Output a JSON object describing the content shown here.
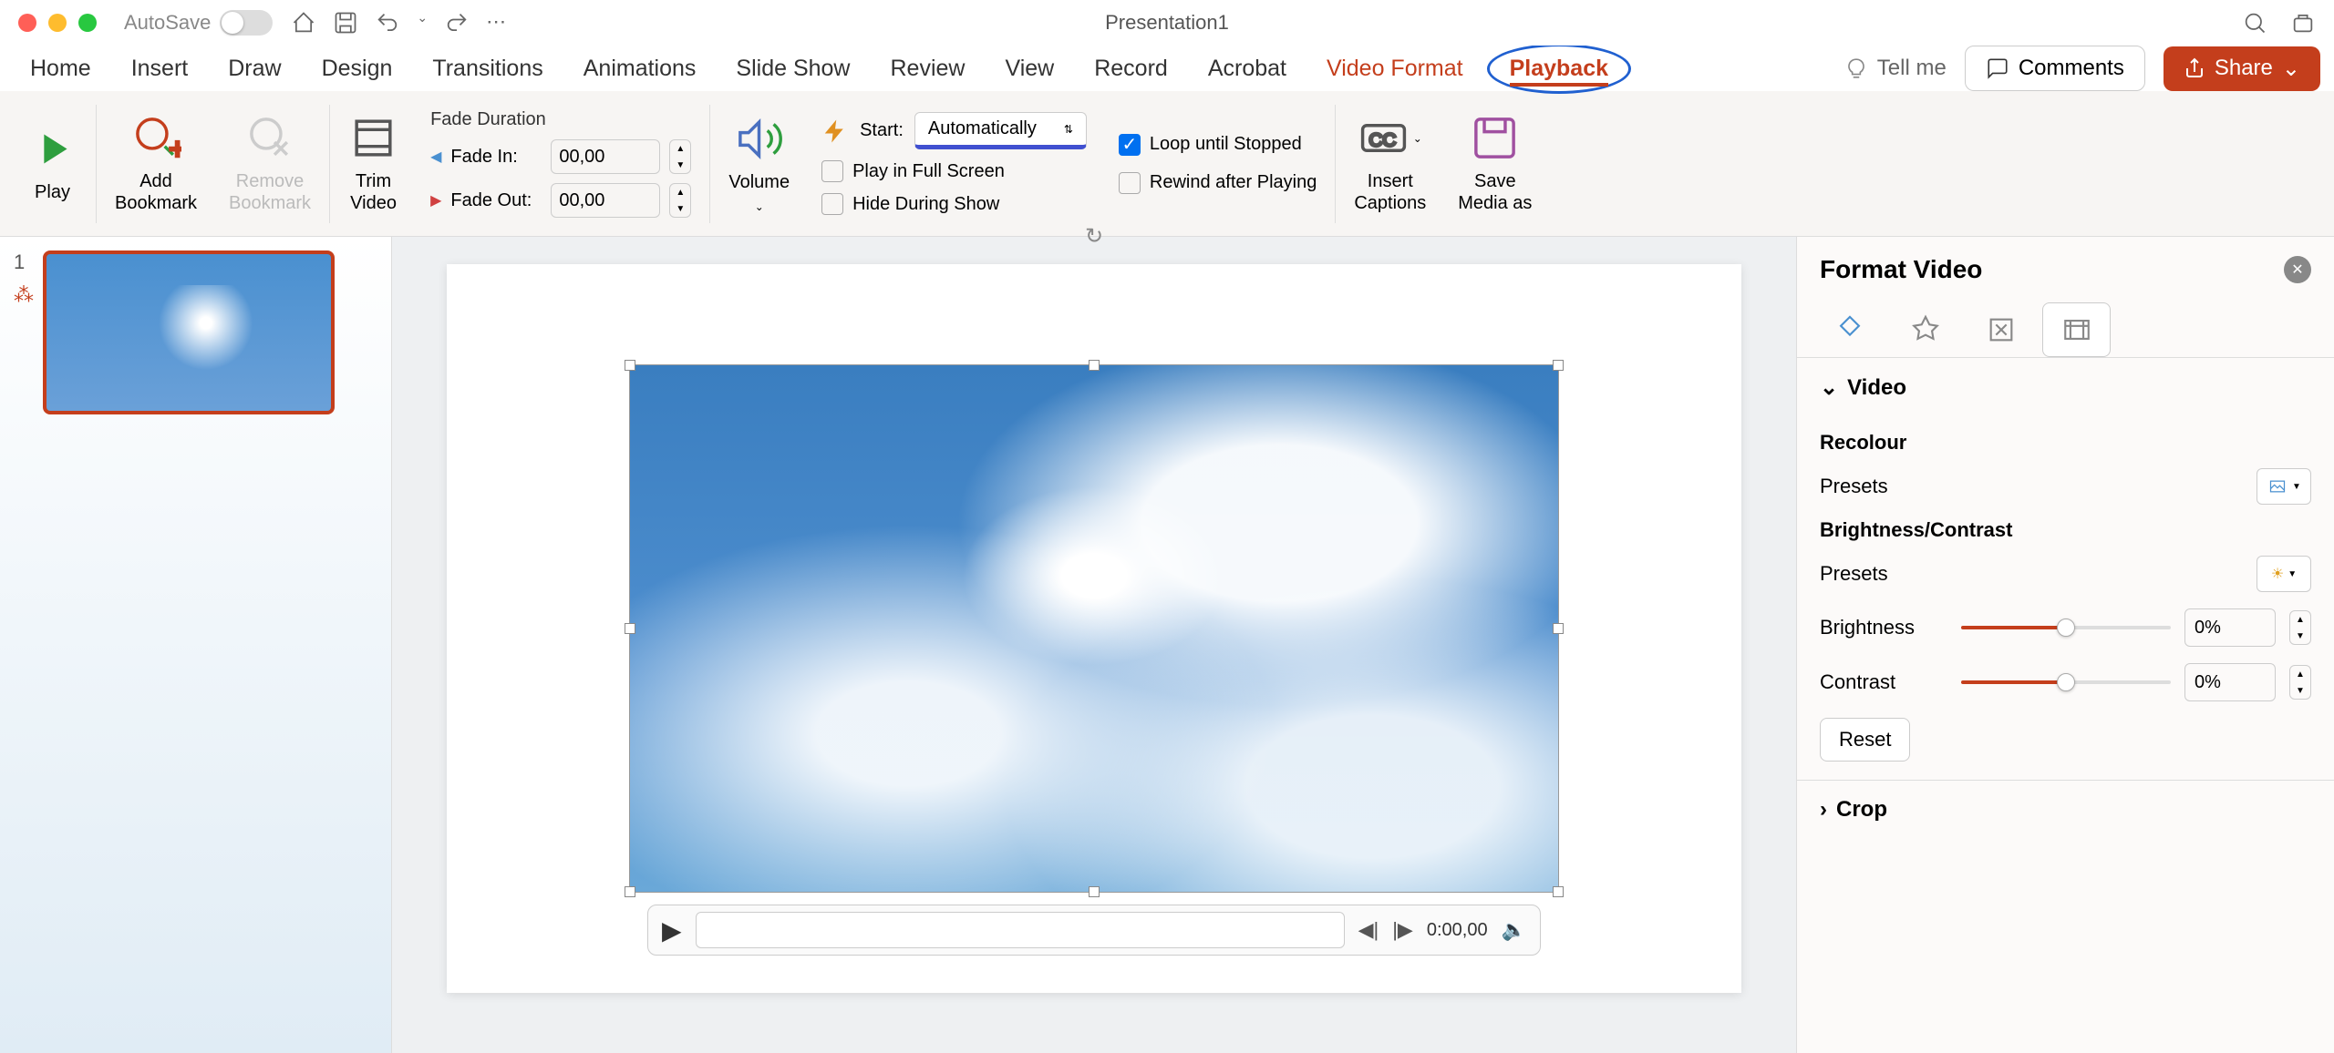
{
  "titlebar": {
    "autosave": "AutoSave",
    "title": "Presentation1"
  },
  "ribbon": {
    "tabs": [
      "Home",
      "Insert",
      "Draw",
      "Design",
      "Transitions",
      "Animations",
      "Slide Show",
      "Review",
      "View",
      "Record",
      "Acrobat",
      "Video Format",
      "Playback"
    ],
    "active_tab": "Playback",
    "tell_me": "Tell me",
    "comments": "Comments",
    "share": "Share"
  },
  "toolbar": {
    "play": "Play",
    "add_bookmark": "Add\nBookmark",
    "remove_bookmark": "Remove\nBookmark",
    "trim_video": "Trim\nVideo",
    "fade_duration": "Fade Duration",
    "fade_in": "Fade In:",
    "fade_out": "Fade Out:",
    "fade_in_value": "00,00",
    "fade_out_value": "00,00",
    "volume": "Volume",
    "start_label": "Start:",
    "start_value": "Automatically",
    "play_full_screen": "Play in Full Screen",
    "hide_during_show": "Hide During Show",
    "loop_until_stopped": "Loop until Stopped",
    "rewind_after_playing": "Rewind after Playing",
    "insert_captions": "Insert\nCaptions",
    "save_media_as": "Save\nMedia as"
  },
  "slide_panel": {
    "slide_number": "1"
  },
  "video_controls": {
    "time": "0:00,00"
  },
  "sidebar": {
    "title": "Format Video",
    "video_section": "Video",
    "recolour": "Recolour",
    "presets": "Presets",
    "brightness_contrast": "Brightness/Contrast",
    "brightness": "Brightness",
    "contrast": "Contrast",
    "brightness_value": "0%",
    "contrast_value": "0%",
    "reset": "Reset",
    "crop": "Crop"
  }
}
